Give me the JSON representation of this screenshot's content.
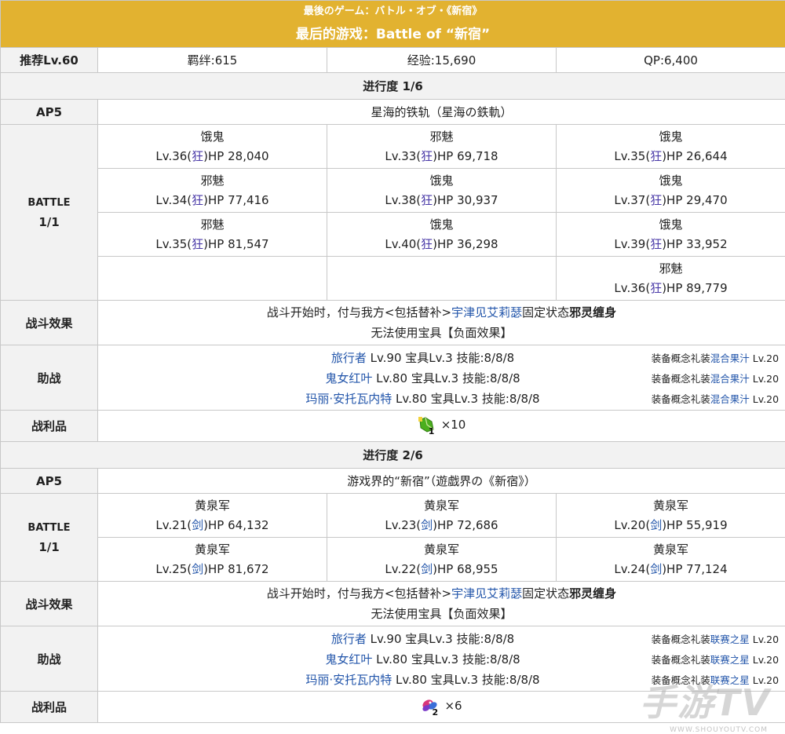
{
  "header": {
    "title_jp": "最後のゲーム：バトル・オブ・《新宿》",
    "title_cn": "最后的游戏：Battle of “新宿”"
  },
  "meta": {
    "rec_level": "推荐Lv.60",
    "bond": "羁绊:615",
    "exp": "经验:15,690",
    "qp": "QP:6,400"
  },
  "labels": {
    "battle_line1": "BATTLE",
    "battle_line2": "1/1",
    "effect": "战斗效果",
    "support": "助战",
    "loot": "战利品",
    "ap": "AP5"
  },
  "progress1": {
    "title": "进行度 1/6",
    "quest_name": "星海的铁轨（星海の鉄軌）",
    "enemies": [
      {
        "name": "饿鬼",
        "lv": "Lv.36(",
        "cls": "狂",
        "hp": ")HP 28,040"
      },
      {
        "name": "邪魅",
        "lv": "Lv.33(",
        "cls": "狂",
        "hp": ")HP 69,718"
      },
      {
        "name": "饿鬼",
        "lv": "Lv.35(",
        "cls": "狂",
        "hp": ")HP 26,644"
      },
      {
        "name": "邪魅",
        "lv": "Lv.34(",
        "cls": "狂",
        "hp": ")HP 77,416"
      },
      {
        "name": "饿鬼",
        "lv": "Lv.38(",
        "cls": "狂",
        "hp": ")HP 30,937"
      },
      {
        "name": "饿鬼",
        "lv": "Lv.37(",
        "cls": "狂",
        "hp": ")HP 29,470"
      },
      {
        "name": "邪魅",
        "lv": "Lv.35(",
        "cls": "狂",
        "hp": ")HP 81,547"
      },
      {
        "name": "饿鬼",
        "lv": "Lv.40(",
        "cls": "狂",
        "hp": ")HP 36,298"
      },
      {
        "name": "饿鬼",
        "lv": "Lv.39(",
        "cls": "狂",
        "hp": ")HP 33,952"
      },
      {
        "name": "邪魅",
        "lv": "Lv.36(",
        "cls": "狂",
        "hp": ")HP 89,779"
      }
    ],
    "effect_pre": "战斗开始时，付与我方<包括替补>",
    "effect_servant": "宇津见艾莉瑟",
    "effect_mid": "固定状态",
    "effect_state": "邪灵缠身",
    "effect_line2": "无法使用宝具【负面效果】",
    "supports": [
      {
        "name": "旅行者",
        "info": " Lv.90 宝具Lv.3 技能:8/8/8",
        "ce_pre": "装备概念礼装",
        "ce": "混合果汁",
        "ce_lv": " Lv.20"
      },
      {
        "name": "鬼女红叶",
        "info": " Lv.80 宝具Lv.3 技能:8/8/8",
        "ce_pre": "装备概念礼装",
        "ce": "混合果汁",
        "ce_lv": " Lv.20"
      },
      {
        "name": "玛丽·安托瓦内特",
        "info": " Lv.80 宝具Lv.3 技能:8/8/8",
        "ce_pre": "装备概念礼装",
        "ce": "混合果汁",
        "ce_lv": " Lv.20"
      }
    ],
    "loot_icon": "green-item-icon",
    "loot_num": "1",
    "loot_count": "×10"
  },
  "progress2": {
    "title": "进行度 2/6",
    "quest_name": "游戏界的“新宿”（遊戯界の《新宿》）",
    "enemies": [
      {
        "name": "黄泉军",
        "lv": "Lv.21(",
        "cls": "剑",
        "hp": ")HP 64,132"
      },
      {
        "name": "黄泉军",
        "lv": "Lv.23(",
        "cls": "剑",
        "hp": ")HP 72,686"
      },
      {
        "name": "黄泉军",
        "lv": "Lv.20(",
        "cls": "剑",
        "hp": ")HP 55,919"
      },
      {
        "name": "黄泉军",
        "lv": "Lv.25(",
        "cls": "剑",
        "hp": ")HP 81,672"
      },
      {
        "name": "黄泉军",
        "lv": "Lv.22(",
        "cls": "剑",
        "hp": ")HP 68,955"
      },
      {
        "name": "黄泉军",
        "lv": "Lv.24(",
        "cls": "剑",
        "hp": ")HP 77,124"
      }
    ],
    "effect_pre": "战斗开始时，付与我方<包括替补>",
    "effect_servant": "宇津见艾莉瑟",
    "effect_mid": "固定状态",
    "effect_state": "邪灵缠身",
    "effect_line2": "无法使用宝具【负面效果】",
    "supports": [
      {
        "name": "旅行者",
        "info": " Lv.90 宝具Lv.3 技能:8/8/8",
        "ce_pre": "装备概念礼装",
        "ce": "联赛之星",
        "ce_lv": " Lv.20"
      },
      {
        "name": "鬼女红叶",
        "info": " Lv.80 宝具Lv.3 技能:8/8/8",
        "ce_pre": "装备概念礼装",
        "ce": "联赛之星",
        "ce_lv": " Lv.20"
      },
      {
        "name": "玛丽·安托瓦内特",
        "info": " Lv.80 宝具Lv.3 技能:8/8/8",
        "ce_pre": "装备概念礼装",
        "ce": "联赛之星",
        "ce_lv": " Lv.20"
      }
    ],
    "loot_icon": "gem-item-icon",
    "loot_num": "2",
    "loot_count": "×6"
  },
  "watermark": {
    "main": "手游TV",
    "sub": "WWW.SHOUYOUTV.COM"
  }
}
